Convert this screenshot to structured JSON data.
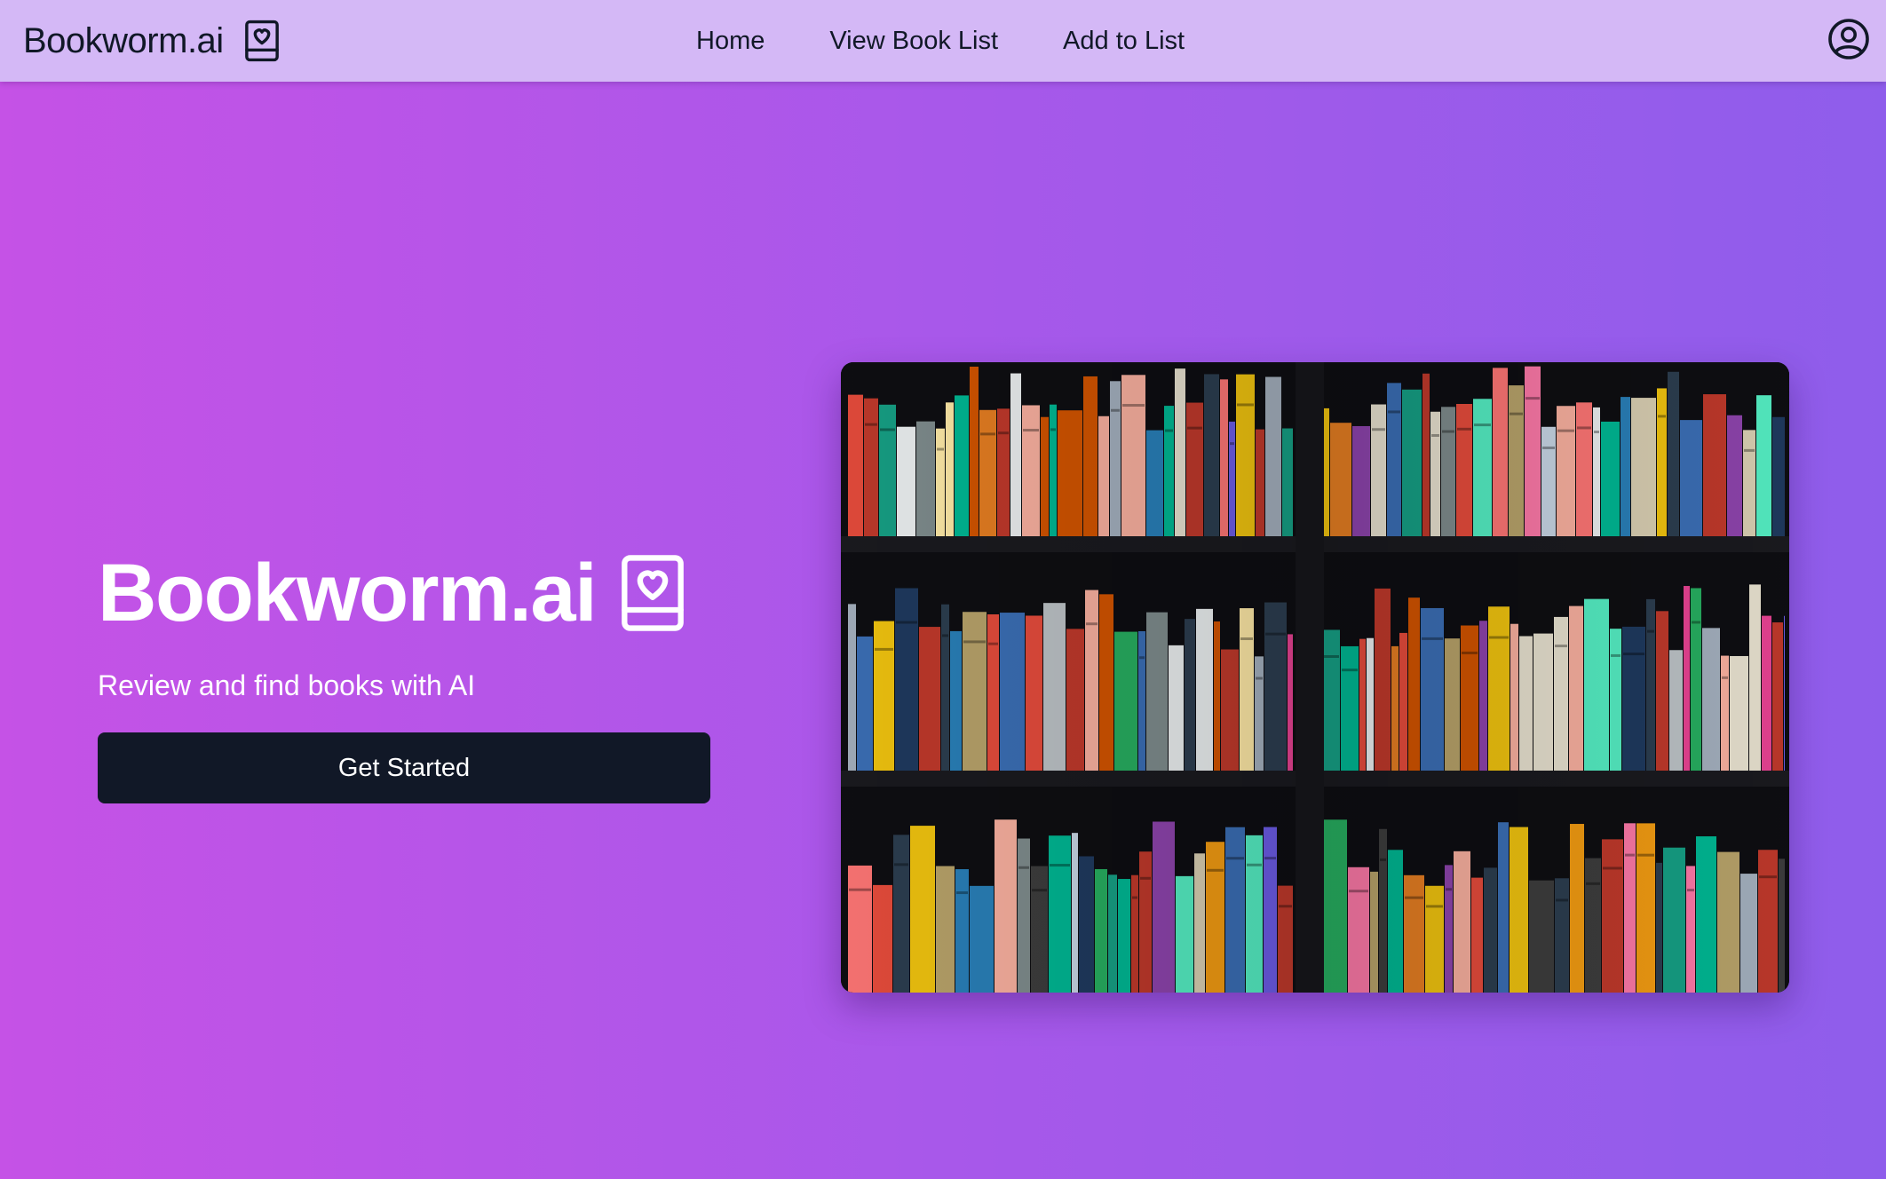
{
  "app": {
    "brand_name": "Bookworm.ai",
    "brand_icon": "book-heart-icon"
  },
  "nav": {
    "links": [
      {
        "label": "Home"
      },
      {
        "label": "View Book List"
      },
      {
        "label": "Add to List"
      }
    ],
    "profile_icon": "user-circle-icon"
  },
  "hero": {
    "title": "Bookworm.ai",
    "subtitle": "Review and find books with AI",
    "cta_label": "Get Started",
    "image_subject": "bookshelf-photo"
  },
  "colors": {
    "navbar_bg": "#d4b8f6",
    "gradient_start": "#c552e6",
    "gradient_end": "#8f5deb",
    "cta_bg": "#111827",
    "text_dark": "#111827",
    "text_light": "#ffffff"
  }
}
